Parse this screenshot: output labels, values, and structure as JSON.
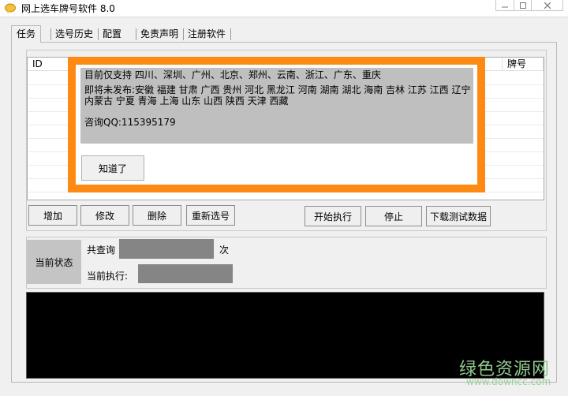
{
  "window": {
    "title": "网上选车牌号软件 8.0",
    "icon": "app-logo-icon"
  },
  "tabs": [
    {
      "label": "任务",
      "active": true
    },
    {
      "label": "选号历史"
    },
    {
      "label": "配置"
    },
    {
      "label": "免责声明"
    },
    {
      "label": "注册软件"
    }
  ],
  "list": {
    "columns": [
      "ID",
      "牌号"
    ]
  },
  "buttons": {
    "add": "增加",
    "edit": "修改",
    "delete": "删除",
    "reselect": "重新选号",
    "start": "开始执行",
    "stop": "停止",
    "download": "下载测试数据"
  },
  "status": {
    "label": "当前状态",
    "query_prefix": "共查询",
    "query_suffix": "次",
    "executing": "当前执行:"
  },
  "popup": {
    "supported": "目前仅支持  四川、深圳、广州、北京、郑州、云南、浙江、广东、重庆",
    "upcoming": "即将未发布:安徽  福建  甘肃 广西 贵州 河北 黑龙江  河南  湖南  湖北  海南  吉林  江苏  江西  辽宁  内蒙古  宁夏  青海  上海  山东  山西  陕西  天津  西藏",
    "contact": "咨询QQ:115395179",
    "ok_label": "知道了"
  },
  "watermark": {
    "title": "绿色资源网",
    "url": "www.downcc.com"
  },
  "colors": {
    "popup_border": "#ff8a13",
    "console_bg": "#000000",
    "field_gray": "#858585",
    "watermark_green": "#8fc98f"
  }
}
